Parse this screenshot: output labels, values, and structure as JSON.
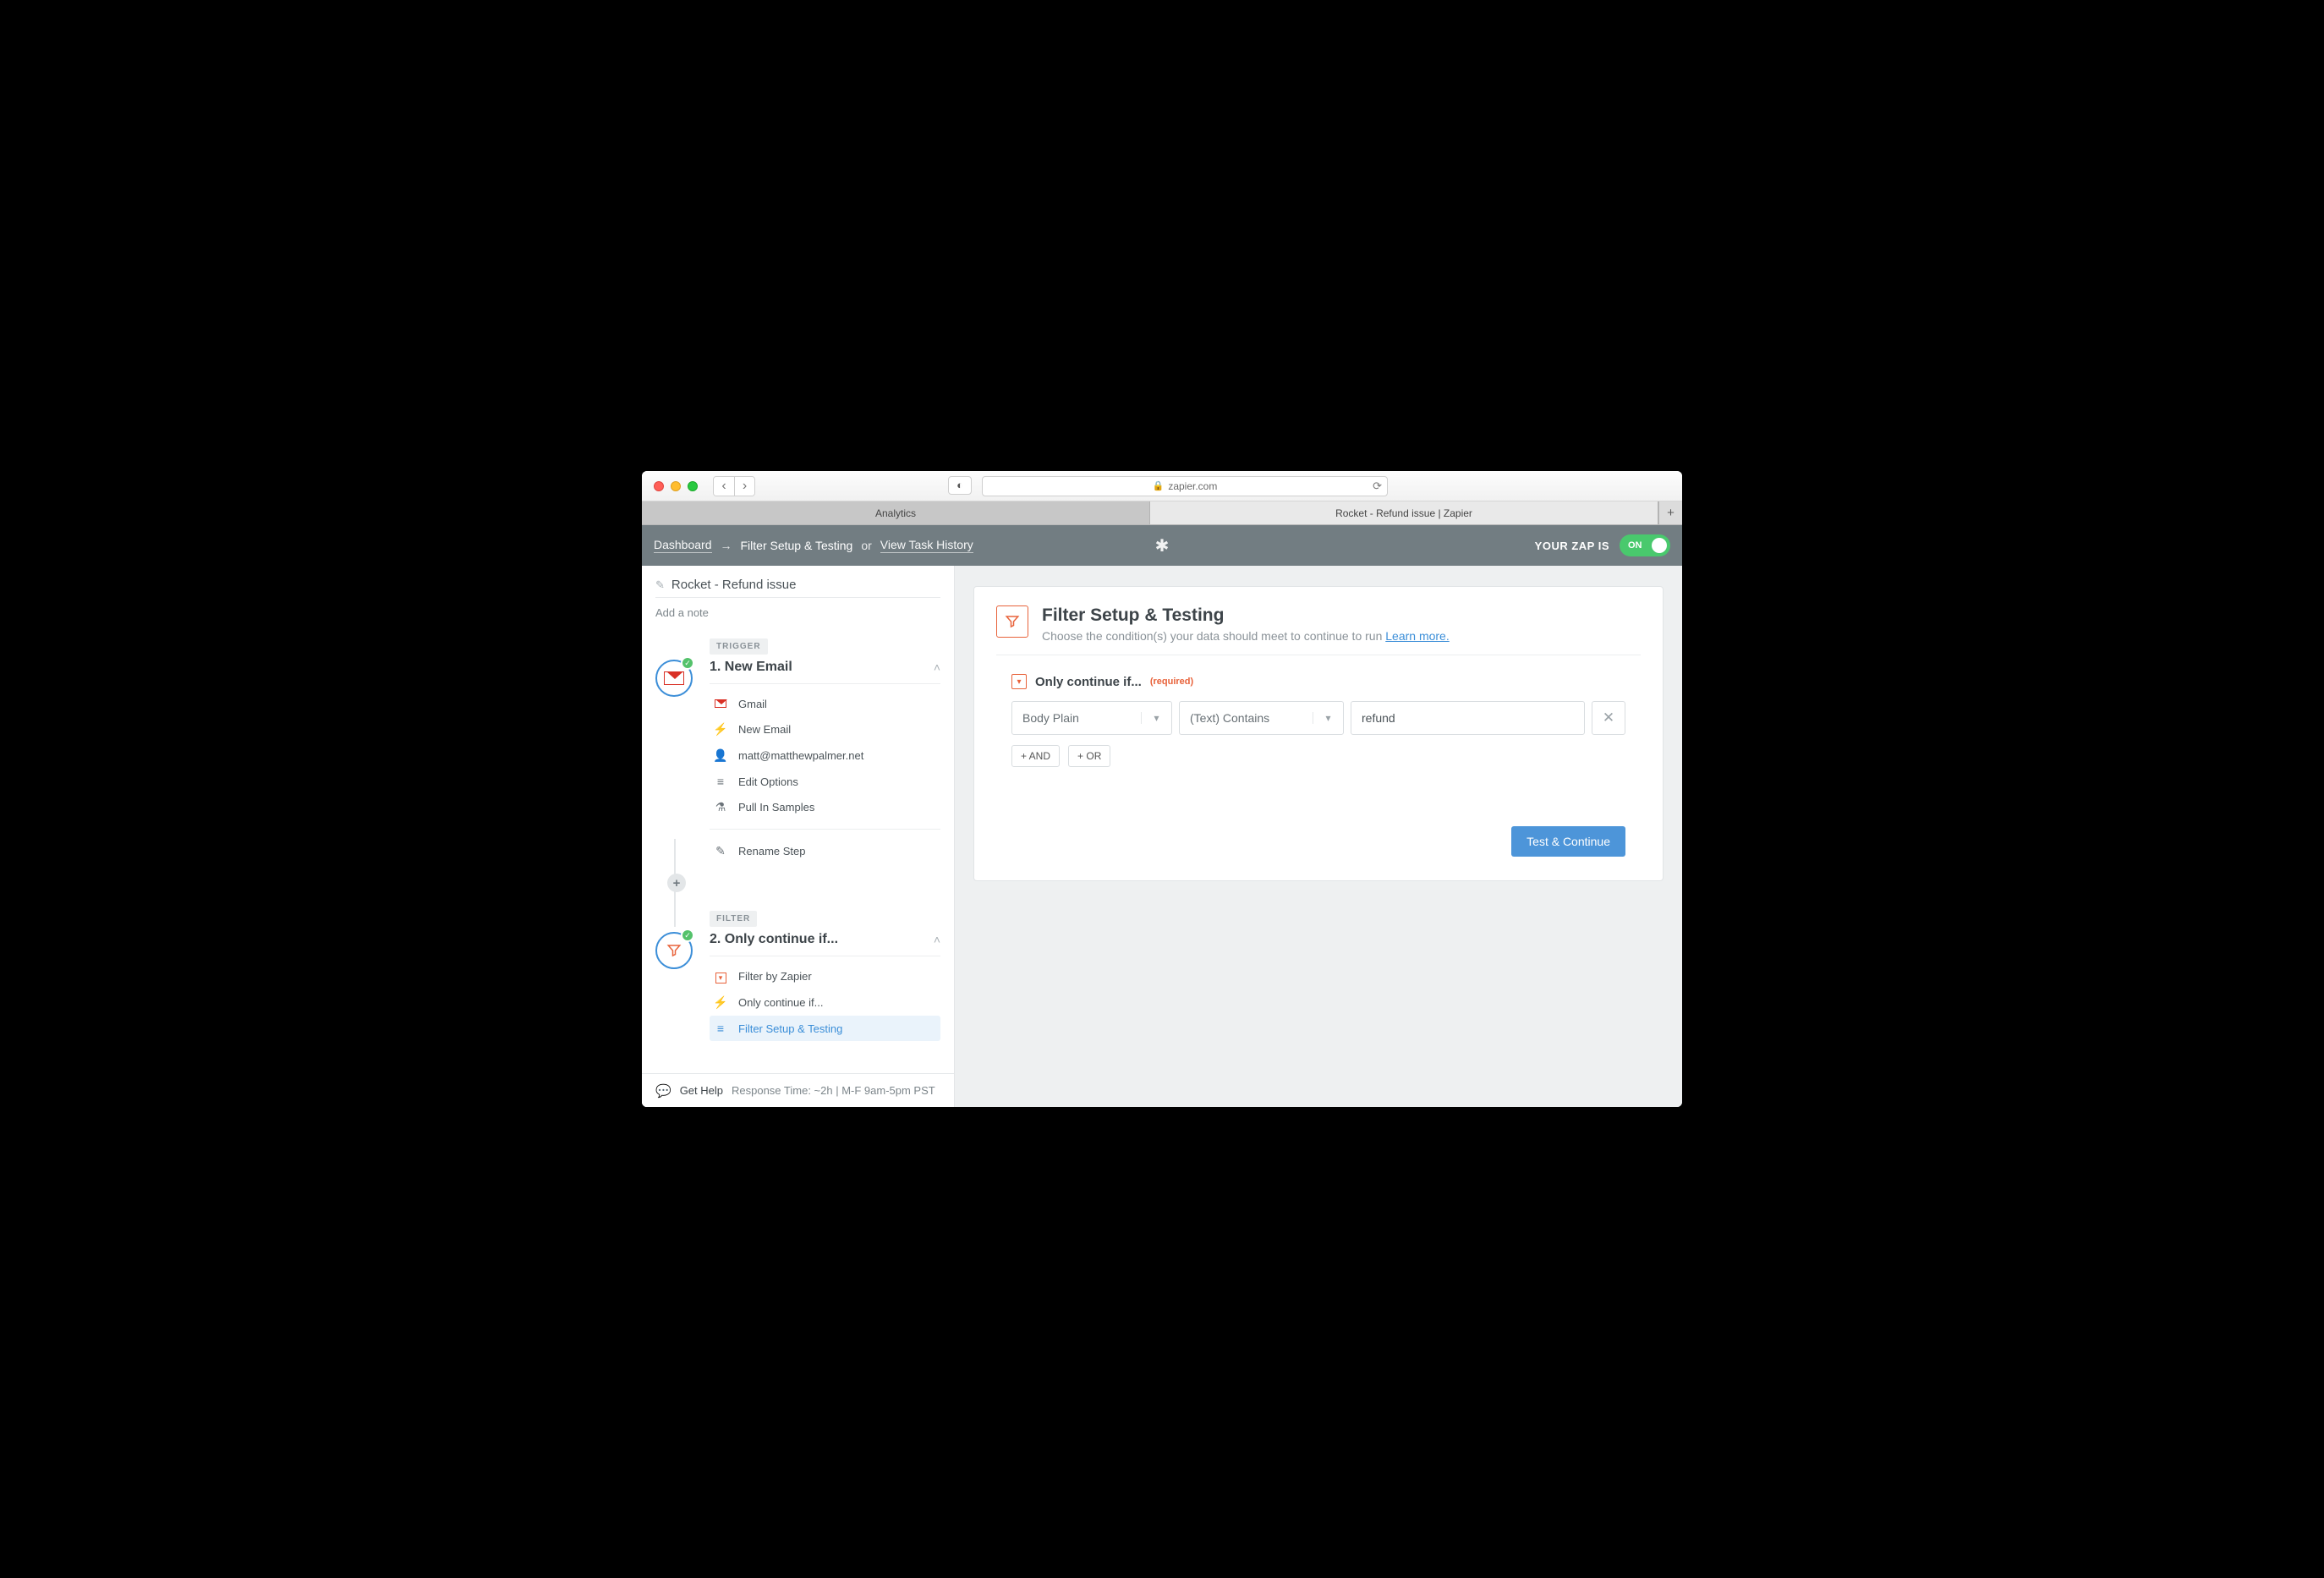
{
  "browser": {
    "url_host": "zapier.com",
    "tabs": [
      "Analytics",
      "Rocket - Refund issue | Zapier"
    ],
    "active_tab_index": 1
  },
  "header": {
    "dashboard": "Dashboard",
    "current": "Filter Setup & Testing",
    "or": "or",
    "view_history": "View Task History",
    "status_label": "YOUR ZAP IS",
    "toggle_state": "ON"
  },
  "zap": {
    "title": "Rocket - Refund issue",
    "add_note": "Add a note"
  },
  "step1": {
    "tag": "TRIGGER",
    "title": "1. New Email",
    "items": {
      "app": "Gmail",
      "event": "New Email",
      "account": "matt@matthewpalmer.net",
      "options": "Edit Options",
      "samples": "Pull In Samples",
      "rename": "Rename Step"
    }
  },
  "step2": {
    "tag": "FILTER",
    "title": "2. Only continue if...",
    "items": {
      "filterby": "Filter by Zapier",
      "only": "Only continue if...",
      "setup": "Filter Setup & Testing"
    }
  },
  "main": {
    "title": "Filter Setup & Testing",
    "subtitle": "Choose the condition(s) your data should meet to continue to run ",
    "learn_more": "Learn more.",
    "filter_label": "Only continue if...",
    "required": "(required)",
    "field_dropdown": "Body Plain",
    "condition_dropdown": "(Text) Contains",
    "value_input": "refund",
    "and_btn": "+ AND",
    "or_btn": "+ OR",
    "test_btn": "Test & Continue"
  },
  "footer": {
    "help": "Get Help",
    "resp": "Response Time: ~2h  |  M-F 9am-5pm PST"
  }
}
